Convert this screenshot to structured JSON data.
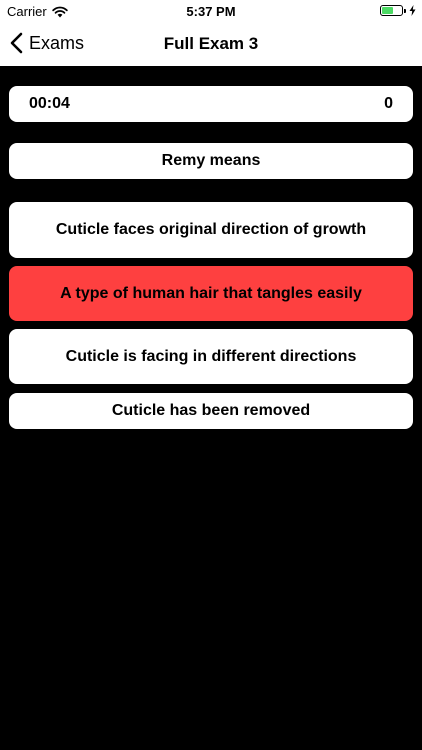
{
  "status_bar": {
    "carrier": "Carrier",
    "time": "5:37 PM",
    "battery_level": 0.6,
    "battery_color": "#4cd964"
  },
  "nav": {
    "back_label": "Exams",
    "back_icon": "chevron-left-icon",
    "title": "Full Exam 3"
  },
  "timer": {
    "elapsed": "00:04",
    "score": "0"
  },
  "question": {
    "text": "Remy means"
  },
  "answers": [
    {
      "text": "Cuticle faces original direction of growth",
      "state": "normal"
    },
    {
      "text": "A type of human hair that tangles easily",
      "state": "incorrect"
    },
    {
      "text": "Cuticle is facing in different directions",
      "state": "normal"
    },
    {
      "text": "Cuticle has been removed",
      "state": "normal"
    }
  ],
  "colors": {
    "background": "#000000",
    "card": "#ffffff",
    "incorrect": "#fe4040"
  }
}
